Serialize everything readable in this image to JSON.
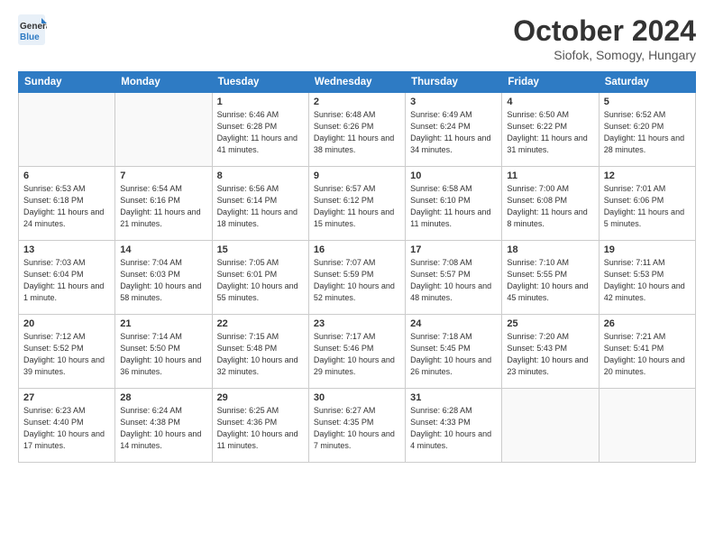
{
  "header": {
    "logo_line1": "General",
    "logo_line2": "Blue",
    "month": "October 2024",
    "location": "Siofok, Somogy, Hungary"
  },
  "days_of_week": [
    "Sunday",
    "Monday",
    "Tuesday",
    "Wednesday",
    "Thursday",
    "Friday",
    "Saturday"
  ],
  "weeks": [
    [
      {
        "day": "",
        "content": ""
      },
      {
        "day": "",
        "content": ""
      },
      {
        "day": "1",
        "content": "Sunrise: 6:46 AM\nSunset: 6:28 PM\nDaylight: 11 hours and 41 minutes."
      },
      {
        "day": "2",
        "content": "Sunrise: 6:48 AM\nSunset: 6:26 PM\nDaylight: 11 hours and 38 minutes."
      },
      {
        "day": "3",
        "content": "Sunrise: 6:49 AM\nSunset: 6:24 PM\nDaylight: 11 hours and 34 minutes."
      },
      {
        "day": "4",
        "content": "Sunrise: 6:50 AM\nSunset: 6:22 PM\nDaylight: 11 hours and 31 minutes."
      },
      {
        "day": "5",
        "content": "Sunrise: 6:52 AM\nSunset: 6:20 PM\nDaylight: 11 hours and 28 minutes."
      }
    ],
    [
      {
        "day": "6",
        "content": "Sunrise: 6:53 AM\nSunset: 6:18 PM\nDaylight: 11 hours and 24 minutes."
      },
      {
        "day": "7",
        "content": "Sunrise: 6:54 AM\nSunset: 6:16 PM\nDaylight: 11 hours and 21 minutes."
      },
      {
        "day": "8",
        "content": "Sunrise: 6:56 AM\nSunset: 6:14 PM\nDaylight: 11 hours and 18 minutes."
      },
      {
        "day": "9",
        "content": "Sunrise: 6:57 AM\nSunset: 6:12 PM\nDaylight: 11 hours and 15 minutes."
      },
      {
        "day": "10",
        "content": "Sunrise: 6:58 AM\nSunset: 6:10 PM\nDaylight: 11 hours and 11 minutes."
      },
      {
        "day": "11",
        "content": "Sunrise: 7:00 AM\nSunset: 6:08 PM\nDaylight: 11 hours and 8 minutes."
      },
      {
        "day": "12",
        "content": "Sunrise: 7:01 AM\nSunset: 6:06 PM\nDaylight: 11 hours and 5 minutes."
      }
    ],
    [
      {
        "day": "13",
        "content": "Sunrise: 7:03 AM\nSunset: 6:04 PM\nDaylight: 11 hours and 1 minute."
      },
      {
        "day": "14",
        "content": "Sunrise: 7:04 AM\nSunset: 6:03 PM\nDaylight: 10 hours and 58 minutes."
      },
      {
        "day": "15",
        "content": "Sunrise: 7:05 AM\nSunset: 6:01 PM\nDaylight: 10 hours and 55 minutes."
      },
      {
        "day": "16",
        "content": "Sunrise: 7:07 AM\nSunset: 5:59 PM\nDaylight: 10 hours and 52 minutes."
      },
      {
        "day": "17",
        "content": "Sunrise: 7:08 AM\nSunset: 5:57 PM\nDaylight: 10 hours and 48 minutes."
      },
      {
        "day": "18",
        "content": "Sunrise: 7:10 AM\nSunset: 5:55 PM\nDaylight: 10 hours and 45 minutes."
      },
      {
        "day": "19",
        "content": "Sunrise: 7:11 AM\nSunset: 5:53 PM\nDaylight: 10 hours and 42 minutes."
      }
    ],
    [
      {
        "day": "20",
        "content": "Sunrise: 7:12 AM\nSunset: 5:52 PM\nDaylight: 10 hours and 39 minutes."
      },
      {
        "day": "21",
        "content": "Sunrise: 7:14 AM\nSunset: 5:50 PM\nDaylight: 10 hours and 36 minutes."
      },
      {
        "day": "22",
        "content": "Sunrise: 7:15 AM\nSunset: 5:48 PM\nDaylight: 10 hours and 32 minutes."
      },
      {
        "day": "23",
        "content": "Sunrise: 7:17 AM\nSunset: 5:46 PM\nDaylight: 10 hours and 29 minutes."
      },
      {
        "day": "24",
        "content": "Sunrise: 7:18 AM\nSunset: 5:45 PM\nDaylight: 10 hours and 26 minutes."
      },
      {
        "day": "25",
        "content": "Sunrise: 7:20 AM\nSunset: 5:43 PM\nDaylight: 10 hours and 23 minutes."
      },
      {
        "day": "26",
        "content": "Sunrise: 7:21 AM\nSunset: 5:41 PM\nDaylight: 10 hours and 20 minutes."
      }
    ],
    [
      {
        "day": "27",
        "content": "Sunrise: 6:23 AM\nSunset: 4:40 PM\nDaylight: 10 hours and 17 minutes."
      },
      {
        "day": "28",
        "content": "Sunrise: 6:24 AM\nSunset: 4:38 PM\nDaylight: 10 hours and 14 minutes."
      },
      {
        "day": "29",
        "content": "Sunrise: 6:25 AM\nSunset: 4:36 PM\nDaylight: 10 hours and 11 minutes."
      },
      {
        "day": "30",
        "content": "Sunrise: 6:27 AM\nSunset: 4:35 PM\nDaylight: 10 hours and 7 minutes."
      },
      {
        "day": "31",
        "content": "Sunrise: 6:28 AM\nSunset: 4:33 PM\nDaylight: 10 hours and 4 minutes."
      },
      {
        "day": "",
        "content": ""
      },
      {
        "day": "",
        "content": ""
      }
    ]
  ]
}
